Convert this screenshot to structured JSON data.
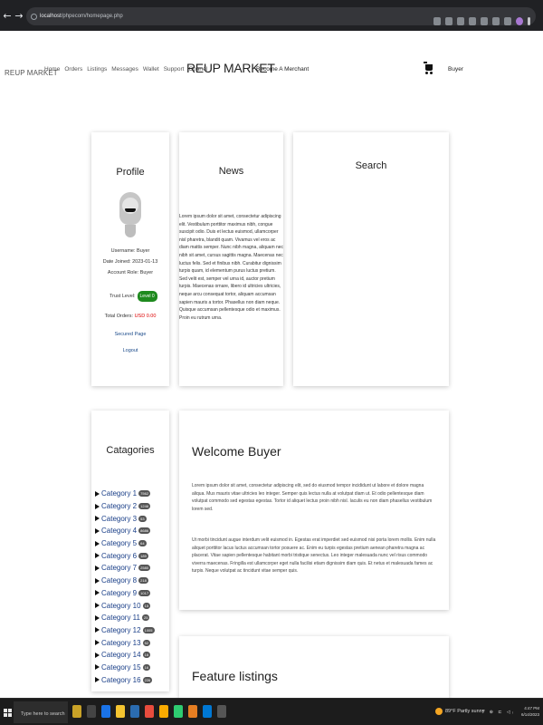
{
  "browser": {
    "back": "←",
    "forward": "→",
    "reload": "C",
    "url_host": "localhost",
    "url_path": "/phpecom/homepage.php"
  },
  "nav": {
    "brand_small": "REUP MARKET",
    "links": [
      "Home",
      "Orders",
      "Listings",
      "Messages",
      "Wallet",
      "Support",
      "Cpanel"
    ],
    "brand_big": "REUP MARKET",
    "merchant": "Become A Merchant",
    "user": "Buyer"
  },
  "profile": {
    "title": "Profile",
    "username": "Username: Buyer",
    "date_joined": "Date Joined: 2023-01-13",
    "role": "Account Role: Buyer",
    "trust_label": "Trust Level:",
    "trust_level": "Level 0",
    "orders_label": "Total Orders:",
    "orders_amount": "USD 0.00",
    "secured_link": "Secured Page",
    "logout_link": "Logout"
  },
  "news": {
    "title": "News",
    "body": "Lorem ipsum dolor sit amet, consectetur adipiscing elit. Vestibulum porttitor maximus nibh, congue suscipit odio. Duis et lectus euismod, ullamcorper nisl pharetra, blandit quam. Vivamus vel eros ac diam mattis semper. Nunc nibh magna, aliquam nec nibh sit amet, cursus sagittis magna. Maecenas nec luctus felis. Sed et finibus nibh. Curabitur dignissim turpis quam, id elementum purus luctus pretium. Sed velit est, semper vel urna id, auctor pretium turpis. Maecenas ornare, libero id ultricies ultricies, neque arcu consequat tortor, aliquam accumsan sapien mauris a tortor. Phasellus non diam neque. Quisque accumsan pellentesque odio et maximus. Proin eu rutrum urna."
  },
  "search": {
    "title": "Search"
  },
  "categories": {
    "title": "Catagories",
    "items": [
      {
        "label": "Category 1",
        "count": "7562"
      },
      {
        "label": "Category 2",
        "count": "1246"
      },
      {
        "label": "Category 3",
        "count": "53"
      },
      {
        "label": "Category 4",
        "count": "8686"
      },
      {
        "label": "Category 5",
        "count": "64"
      },
      {
        "label": "Category 6",
        "count": "189"
      },
      {
        "label": "Category 7",
        "count": "2580"
      },
      {
        "label": "Category 8",
        "count": "218"
      },
      {
        "label": "Category 9",
        "count": "1017"
      },
      {
        "label": "Category 10",
        "count": "15"
      },
      {
        "label": "Category 11",
        "count": "25"
      },
      {
        "label": "Category 12",
        "count": "1005"
      },
      {
        "label": "Category 13",
        "count": "52"
      },
      {
        "label": "Category 14",
        "count": "16"
      },
      {
        "label": "Category 15",
        "count": "16"
      },
      {
        "label": "Category 16",
        "count": "226"
      }
    ]
  },
  "welcome": {
    "title": "Welcome Buyer",
    "p1": "Lorem ipsum dolor sit amet, consectetur adipiscing elit, sed do eiusmod tempor incididunt ut labore et dolore magna aliqua. Mus mauris vitae ultricies leo integer. Semper quis lectus nulla at volutpat diam ut. Et odio pellentesque diam volutpat commodo sed egestas egestas. Tortor id aliquet lectus proin nibh nisl. Iaculis eu non diam phasellus vestibulum lorem sed.",
    "p2": "Ut morbi tincidunt augue interdum velit euismod in. Egestas erat imperdiet sed euismod nisi porta lorem mollis. Enim nulla aliquet porttitor lacus luctus accumsan tortor posuere ac. Enim eu turpis egestas pretium aenean pharetra magna ac placerat. Vitae sapien pellentesque habitant morbi tristique senectus. Leo integer malesuada nunc vel risus commodo viverra maecenas. Fringilla est ullamcorper eget nulla facilisi etiam dignissim diam quis. Et netus et malesuada fames ac turpis. Neque volutpat ac tincidunt vitae semper quis."
  },
  "feature": {
    "title": "Feature listings"
  },
  "taskbar": {
    "search_placeholder": "Type here to search",
    "weather": "89°F  Partly sunny",
    "tray": "^ ⊕ ⊏ ◁ᵢ",
    "time": "4:47 PM",
    "date": "6/14/2023"
  },
  "colors": {
    "trust_badge": "#1e8a1e",
    "orders_amount": "#dd0000",
    "link": "#1a4a8a",
    "category_link": "#1a3f88",
    "taskbar": "#1c1c1c"
  }
}
